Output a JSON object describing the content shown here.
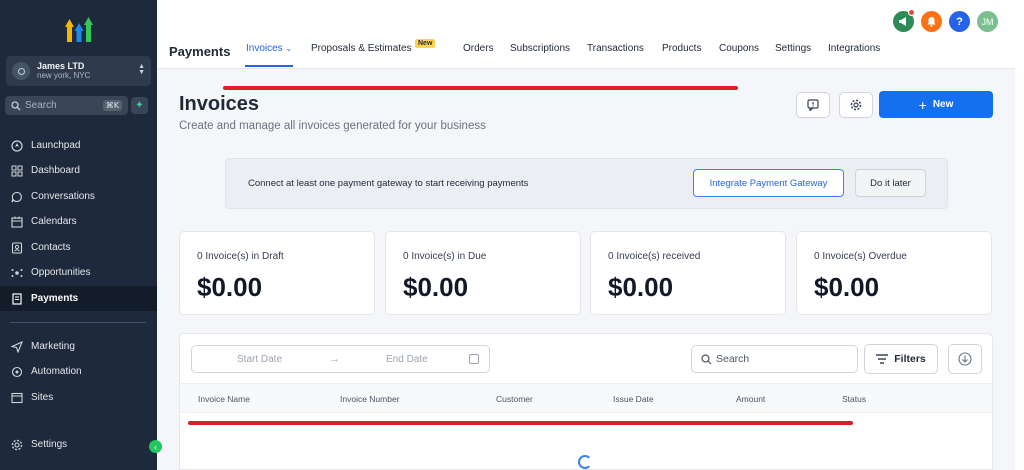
{
  "account": {
    "name": "James LTD",
    "location": "new york, NYC"
  },
  "sidebar_search": {
    "placeholder": "Search",
    "shortcut": "⌘K"
  },
  "sidebar": {
    "items": [
      {
        "label": "Launchpad",
        "icon": "rocket-icon"
      },
      {
        "label": "Dashboard",
        "icon": "grid-icon"
      },
      {
        "label": "Conversations",
        "icon": "chat-icon"
      },
      {
        "label": "Calendars",
        "icon": "calendar-icon"
      },
      {
        "label": "Contacts",
        "icon": "contacts-icon"
      },
      {
        "label": "Opportunities",
        "icon": "opportunities-icon"
      },
      {
        "label": "Payments",
        "icon": "payments-icon",
        "active": true
      },
      {
        "label": "Marketing",
        "icon": "send-icon"
      },
      {
        "label": "Automation",
        "icon": "automation-icon"
      },
      {
        "label": "Sites",
        "icon": "sites-icon"
      },
      {
        "label": "Settings",
        "icon": "gear-icon"
      }
    ]
  },
  "topbar": {
    "section_title": "Payments",
    "user_initials": "JM",
    "help_label": "?",
    "tabs": [
      {
        "label": "Invoices",
        "active": true
      },
      {
        "label": "Proposals & Estimates",
        "badge": "New"
      },
      {
        "label": "Orders"
      },
      {
        "label": "Subscriptions"
      },
      {
        "label": "Transactions"
      },
      {
        "label": "Products"
      },
      {
        "label": "Coupons"
      },
      {
        "label": "Settings"
      },
      {
        "label": "Integrations"
      }
    ]
  },
  "page": {
    "title": "Invoices",
    "subtitle": "Create and manage all invoices generated for your business",
    "new_button": "New"
  },
  "banner": {
    "message": "Connect at least one payment gateway to start receiving payments",
    "primary_button": "Integrate Payment Gateway",
    "secondary_button": "Do it later"
  },
  "stats": [
    {
      "label": "0 Invoice(s) in Draft",
      "amount": "$0.00"
    },
    {
      "label": "0 Invoice(s) in Due",
      "amount": "$0.00"
    },
    {
      "label": "0 Invoice(s) received",
      "amount": "$0.00"
    },
    {
      "label": "0 Invoice(s) Overdue",
      "amount": "$0.00"
    }
  ],
  "table": {
    "start_date_placeholder": "Start Date",
    "end_date_placeholder": "End Date",
    "search_placeholder": "Search",
    "filters_label": "Filters",
    "columns": [
      "Invoice Name",
      "Invoice Number",
      "Customer",
      "Issue Date",
      "Amount",
      "Status"
    ]
  },
  "colors": {
    "sidebar_bg": "#1e2a3b",
    "accent": "#1570ef",
    "annotation_red": "#e11d25",
    "announce": "#2e8b57",
    "notify": "#f97316",
    "help": "#2563eb",
    "avatar": "#7bbf8e"
  }
}
